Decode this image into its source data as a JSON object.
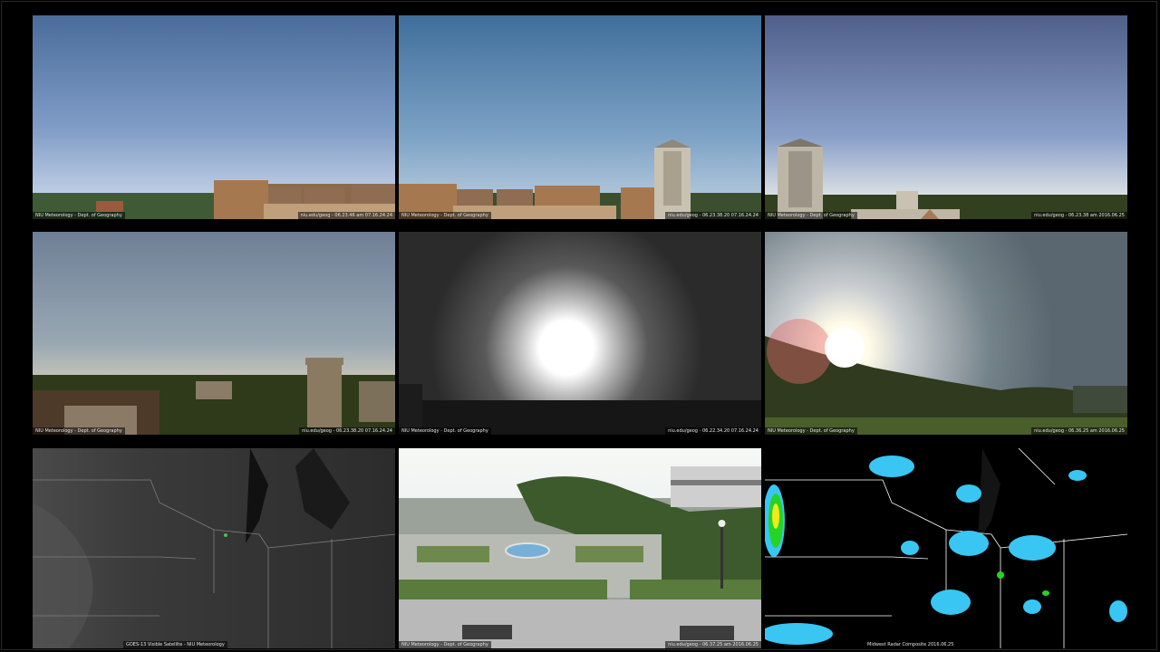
{
  "page": {
    "background": "#000000"
  },
  "cameras": [
    {
      "id": "cam-1",
      "view": "sky-rooftops",
      "caption_left": "NIU Meteorology - Dept. of Geography",
      "caption_right": "niu.edu/geog - 06.23.46 am 07.16.24.24"
    },
    {
      "id": "cam-2",
      "view": "sky-tower-right",
      "caption_left": "NIU Meteorology - Dept. of Geography",
      "caption_right": "niu.edu/geog - 06.23.38.20 07.16.24.24"
    },
    {
      "id": "cam-3",
      "view": "sky-tower-left",
      "caption_left": "NIU Meteorology - Dept. of Geography",
      "caption_right": "niu.edu/geog - 06.23.38 am 2016.06.25"
    },
    {
      "id": "cam-4",
      "view": "sunrise-castle",
      "caption_left": "NIU Meteorology - Dept. of Geography",
      "caption_right": "niu.edu/geog - 06.23.38.20 07.16.24.24"
    },
    {
      "id": "cam-5",
      "view": "sun-glare-mono",
      "caption_left": "NIU Meteorology - Dept. of Geography",
      "caption_right": "niu.edu/geog - 06.22.34.20 07.16.24.24"
    },
    {
      "id": "cam-6",
      "view": "sun-glare-trees",
      "caption_left": "NIU Meteorology - Dept. of Geography",
      "caption_right": "niu.edu/geog - 06.36.25 am 2016.06.25"
    },
    {
      "id": "satellite",
      "view": "satellite-visible",
      "caption_center": "GOES-13 Visible Satellite - NIU Meteorology"
    },
    {
      "id": "cam-7",
      "view": "campus-mall",
      "caption_left": "NIU Meteorology - Dept. of Geography",
      "caption_right": "niu.edu/geog - 06.37.25 am 2016.06.25"
    },
    {
      "id": "radar",
      "view": "radar-composite",
      "caption_center": "Midwest Radar Composite 2016.06.25",
      "colors": {
        "light": "#39c6f2",
        "moderate": "#25d425",
        "heavy": "#f0ea1c",
        "background": "#000000"
      }
    }
  ]
}
